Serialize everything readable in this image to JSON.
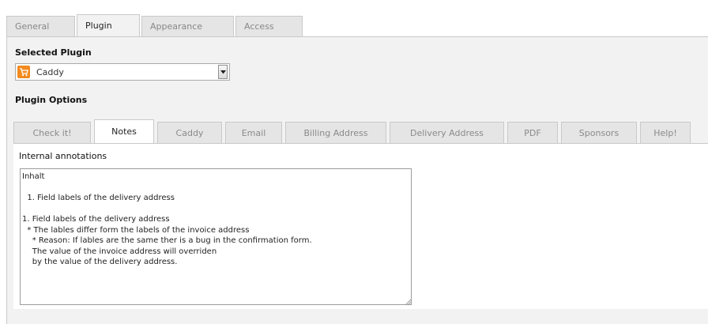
{
  "top_tabs": [
    {
      "label": "General"
    },
    {
      "label": "Plugin"
    },
    {
      "label": "Appearance"
    },
    {
      "label": "Access"
    }
  ],
  "selected_plugin": {
    "label": "Selected Plugin",
    "value": "Caddy",
    "icon": "shopping-cart-icon"
  },
  "plugin_options": {
    "label": "Plugin Options"
  },
  "sub_tabs": [
    {
      "label": "Check it!"
    },
    {
      "label": "Notes"
    },
    {
      "label": "Caddy"
    },
    {
      "label": "Email"
    },
    {
      "label": "Billing Address"
    },
    {
      "label": "Delivery Address"
    },
    {
      "label": "PDF"
    },
    {
      "label": "Sponsors"
    },
    {
      "label": "Help!"
    }
  ],
  "notes": {
    "label": "Internal annotations",
    "value": "Inhalt\n\n  1. Field labels of the delivery address\n\n1. Field labels of the delivery address\n  * The lables differ form the labels of the invoice address\n    * Reason: If lables are the same ther is a bug in the confirmation form.\n    The value of the invoice address will overriden\n    by the value of the delivery address."
  },
  "colors": {
    "panel_background": "#f2f2f2",
    "tab_inactive": "#e5e5e5",
    "border": "#c9c9c9",
    "cart_icon": "#f28a1e"
  }
}
